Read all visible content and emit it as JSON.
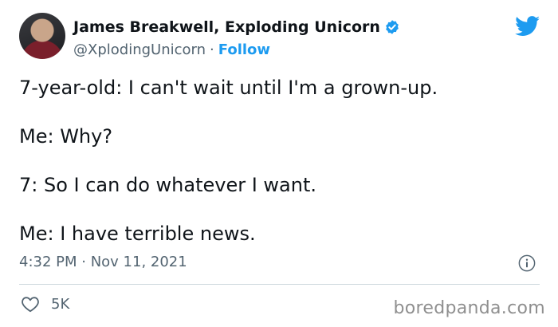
{
  "author": {
    "name": "James Breakwell, Exploding Unicorn",
    "handle": "@XplodingUnicorn",
    "separator": "·",
    "follow_label": "Follow"
  },
  "tweet": {
    "lines": [
      "7-year-old: I can't wait until I'm a grown-up.",
      "Me: Why?",
      "7: So I can do whatever I want.",
      "Me: I have terrible news."
    ],
    "timestamp": "4:32 PM · Nov 11, 2021"
  },
  "engagement": {
    "likes": "5K"
  },
  "watermark": "boredpanda.com",
  "icons": {
    "verified": "verified-badge-icon",
    "bird": "twitter-bird-icon",
    "info": "info-icon",
    "heart": "heart-icon"
  },
  "colors": {
    "accent": "#1d9bf0",
    "text": "#0f1419",
    "muted": "#536471",
    "divider": "#cfd9de"
  }
}
